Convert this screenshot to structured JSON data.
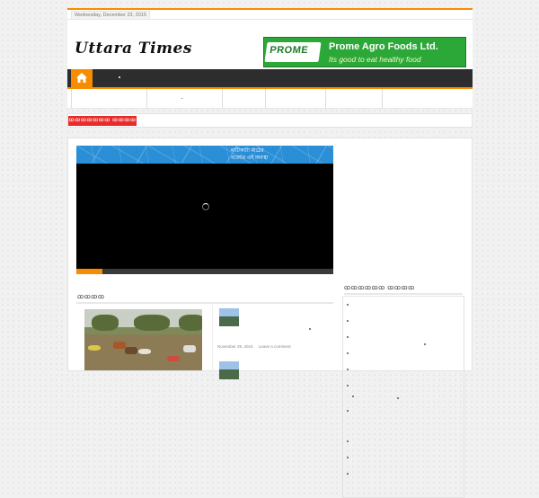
{
  "topbar": {
    "date": "Wednesday, December 23, 2015"
  },
  "header": {
    "logo_text": "Uttara Times"
  },
  "ad": {
    "brand": "PROME",
    "name": "Prome Agro Foods Ltd.",
    "tagline": "Its good to eat healthy food",
    "color": "#2ca838"
  },
  "nav": {
    "home_icon": "home-icon",
    "accent_color": "#f88c00"
  },
  "breaking": {
    "label": "ꝏꝏꝏꝏꝏꝏꝏ ꝏꝏꝏꝏ"
  },
  "video": {
    "caption_line1": "মাটিকাটা মাঠের",
    "caption_line2": "বর্জ্যের এই অবস্থা",
    "progress": 0.1
  },
  "section": {
    "title": "ꝏꝏꝏꝏ"
  },
  "side_list": {
    "items": [
      {
        "date": "November 29, 2015",
        "comment": "Leave a comment"
      }
    ]
  },
  "sidebar": {
    "title": "ꝏꝏꝏꝏꝏꝏ ꝏꝏꝏꝏ"
  }
}
